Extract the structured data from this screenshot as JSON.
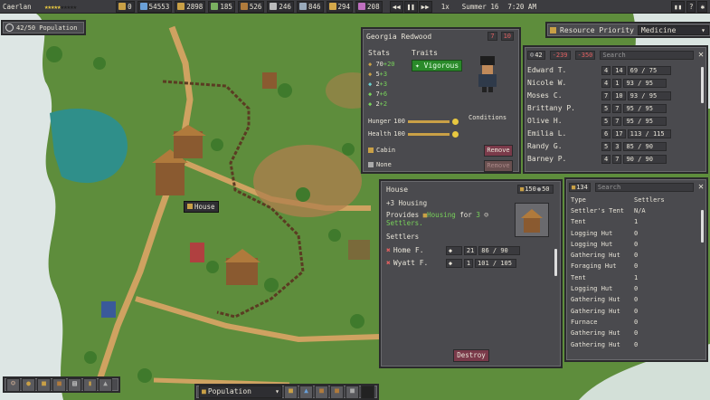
{
  "topbar": {
    "colony": "Caerlan",
    "stars": 5,
    "resources": [
      {
        "icon": "gear-icon",
        "value": "0",
        "color": "#c9a046"
      },
      {
        "icon": "research-icon",
        "value": "54553",
        "color": "#6aa0d8"
      },
      {
        "icon": "food-icon",
        "value": "2898",
        "color": "#c9a046"
      },
      {
        "icon": "wood-icon",
        "value": "185",
        "color": "#7ab060"
      },
      {
        "icon": "stone-icon",
        "value": "526",
        "color": "#b07b3c"
      },
      {
        "icon": "tool-icon",
        "value": "246",
        "color": "#bbb"
      },
      {
        "icon": "iron-icon",
        "value": "846",
        "color": "#9ab"
      },
      {
        "icon": "coin-icon",
        "value": "294",
        "color": "#d4a84a"
      },
      {
        "icon": "gem-icon",
        "value": "208",
        "color": "#c070c0"
      }
    ],
    "speed": "1x",
    "season": "Summer 16",
    "time": "7:20 AM"
  },
  "population_widget": "42/50 Population",
  "resource_priority": {
    "label": "Resource Priority",
    "value": "Medicine"
  },
  "character": {
    "name": "Georgia Redwood",
    "badge_a": "7",
    "badge_b": "10",
    "stats_header": "Stats",
    "traits_header": "Traits",
    "stats": [
      {
        "icon": "gold",
        "value": "70",
        "bonus": "+20"
      },
      {
        "icon": "gold",
        "value": "5",
        "bonus": "+3"
      },
      {
        "icon": "cyan",
        "value": "2",
        "bonus": "+3"
      },
      {
        "icon": "green",
        "value": "7",
        "bonus": "+6"
      },
      {
        "icon": "green",
        "value": "2",
        "bonus": "+2"
      }
    ],
    "trait": "Vigorous",
    "hunger_label": "Hunger",
    "hunger_value": "100",
    "health_label": "Health",
    "health_value": "100",
    "conditions_label": "Conditions",
    "home": "Cabin",
    "work": "None",
    "remove": "Remove"
  },
  "settlers_panel": {
    "count": "42",
    "a": "-239",
    "b": "-350",
    "search_placeholder": "Search",
    "rows": [
      {
        "name": "Edward T.",
        "c1": "4",
        "c2": "14",
        "hp": "69 / 75"
      },
      {
        "name": "Nicole W.",
        "c1": "4",
        "c2": "1",
        "hp": "93 / 95"
      },
      {
        "name": "Moses C.",
        "c1": "7",
        "c2": "10",
        "hp": "93 / 95"
      },
      {
        "name": "Brittany P.",
        "c1": "5",
        "c2": "7",
        "hp": "95 / 95"
      },
      {
        "name": "Olive H.",
        "c1": "5",
        "c2": "7",
        "hp": "95 / 95"
      },
      {
        "name": "Emilia L.",
        "c1": "6",
        "c2": "17",
        "hp": "113 / 115"
      },
      {
        "name": "Randy G.",
        "c1": "5",
        "c2": "3",
        "hp": "85 / 90"
      },
      {
        "name": "Barney P.",
        "c1": "4",
        "c2": "7",
        "hp": "90 / 90"
      }
    ]
  },
  "house_panel": {
    "title": "House",
    "cost_a": "150",
    "cost_b": "50",
    "housing": "+3 Housing",
    "provides_a": "Provides",
    "provides_b": "Housing",
    "provides_c": "for",
    "provides_d": "3",
    "provides_e": "Settlers.",
    "settlers_label": "Settlers",
    "rows": [
      {
        "name": "Home F.",
        "a": "21",
        "hp": "86 / 90"
      },
      {
        "name": "Wyatt F.",
        "a": "1",
        "hp": "101 / 105"
      }
    ],
    "destroy": "Destroy"
  },
  "buildings_panel": {
    "count": "134",
    "search_placeholder": "Search",
    "col_type": "Type",
    "col_settlers": "Settlers",
    "rows": [
      {
        "type": "Settler's Tent",
        "settlers": "N/A"
      },
      {
        "type": "Tent",
        "settlers": "1"
      },
      {
        "type": "Logging Hut",
        "settlers": "0"
      },
      {
        "type": "Logging Hut",
        "settlers": "0"
      },
      {
        "type": "Gathering Hut",
        "settlers": "0"
      },
      {
        "type": "Foraging Hut",
        "settlers": "0"
      },
      {
        "type": "Tent",
        "settlers": "1"
      },
      {
        "type": "Logging Hut",
        "settlers": "0"
      },
      {
        "type": "Gathering Hut",
        "settlers": "0"
      },
      {
        "type": "Gathering Hut",
        "settlers": "0"
      },
      {
        "type": "Furnace",
        "settlers": "0"
      },
      {
        "type": "Gathering Hut",
        "settlers": "0"
      },
      {
        "type": "Gathering Hut",
        "settlers": "0"
      }
    ]
  },
  "map_label": "House",
  "bottom": {
    "population_select": "Population"
  }
}
